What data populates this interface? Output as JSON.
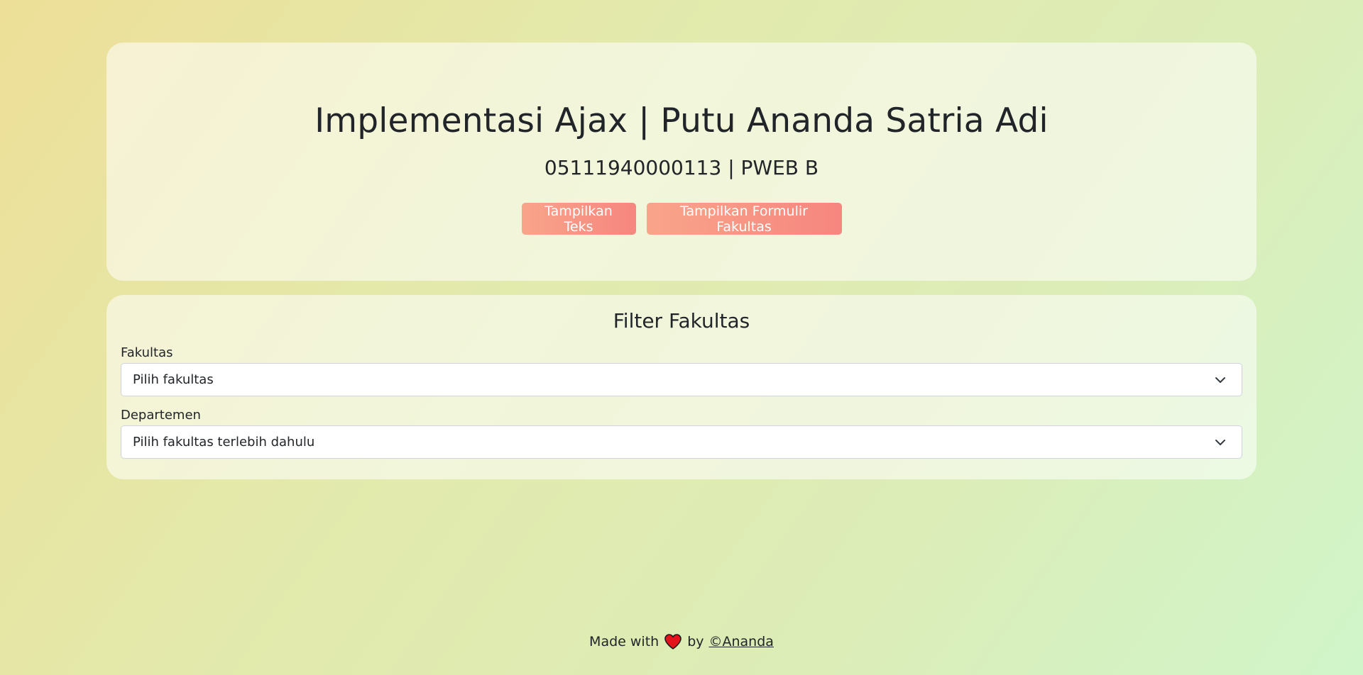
{
  "header": {
    "title": "Implementasi Ajax | Putu Ananda Satria Adi",
    "subtitle": "05111940000113 | PWEB B",
    "buttons": {
      "show_text": "Tampilkan Teks",
      "show_form": "Tampilkan Formulir Fakultas"
    }
  },
  "filter": {
    "title": "Filter Fakultas",
    "fakultas": {
      "label": "Fakultas",
      "selected": "Pilih fakultas"
    },
    "departemen": {
      "label": "Departemen",
      "selected": "Pilih fakultas terlebih dahulu"
    }
  },
  "footer": {
    "made_with": "Made with",
    "by": "by",
    "author_link": "©Ananda"
  },
  "colors": {
    "button_gradient_start": "#f9a58a",
    "button_gradient_end": "#f6867f",
    "heart": "#e3121b"
  },
  "icons": {
    "select_arrow": "chevron-down-icon",
    "heart": "heart-icon"
  }
}
